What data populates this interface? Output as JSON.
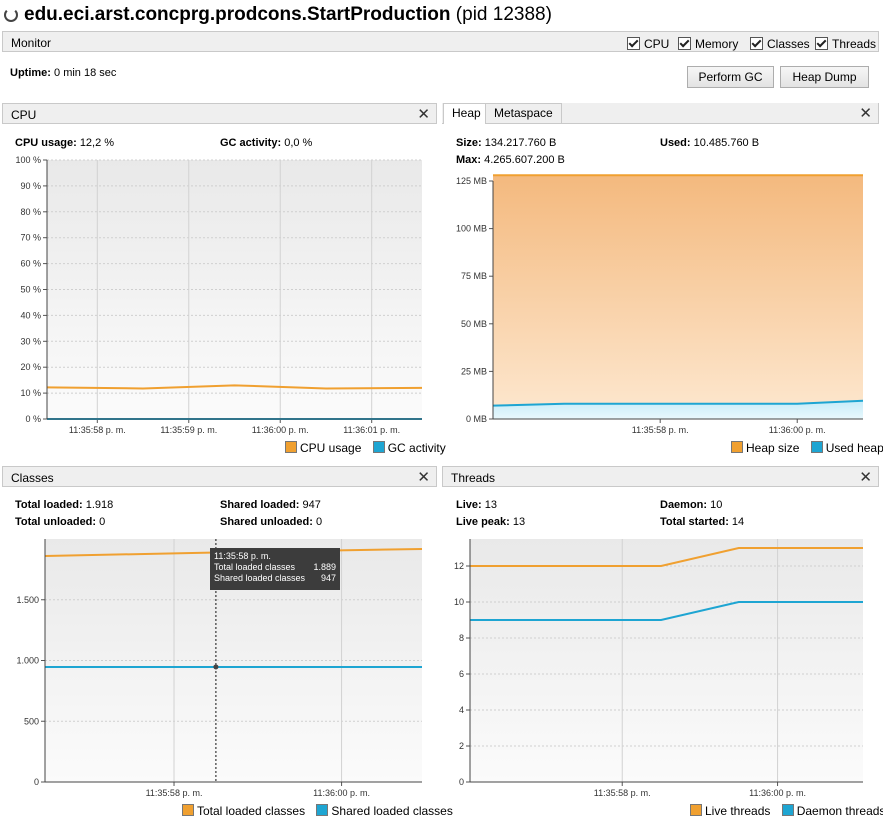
{
  "window": {
    "process": "edu.eci.arst.concprg.prodcons.StartProduction",
    "pid": "(pid 12388)"
  },
  "monitor": {
    "label": "Monitor",
    "checkboxes": [
      {
        "label": "CPU",
        "checked": true
      },
      {
        "label": "Memory",
        "checked": true
      },
      {
        "label": "Classes",
        "checked": true
      },
      {
        "label": "Threads",
        "checked": true
      }
    ],
    "uptime_label": "Uptime:",
    "uptime_value": "0 min 18 sec",
    "perform_gc": "Perform GC",
    "heap_dump": "Heap Dump"
  },
  "cpu": {
    "label": "CPU",
    "close": "✕",
    "usage_label": "CPU usage:",
    "usage_value": "12,2 %",
    "gc_label": "GC activity:",
    "gc_value": "0,0 %",
    "legend": [
      {
        "label": "CPU usage",
        "color": "#f0a030"
      },
      {
        "label": "GC activity",
        "color": "#1ea5d2"
      }
    ]
  },
  "heap": {
    "tabs": [
      "Heap",
      "Metaspace"
    ],
    "close": "✕",
    "size_label": "Size:",
    "size_value": "134.217.760 B",
    "used_label": "Used:",
    "used_value": "10.485.760 B",
    "max_label": "Max:",
    "max_value": "4.265.607.200 B",
    "legend": [
      {
        "label": "Heap size",
        "color": "#f0a030"
      },
      {
        "label": "Used heap",
        "color": "#1ea5d2"
      }
    ]
  },
  "classes": {
    "label": "Classes",
    "close": "✕",
    "total_loaded_label": "Total loaded:",
    "total_loaded_value": "1.918",
    "total_unloaded_label": "Total unloaded:",
    "total_unloaded_value": "0",
    "shared_loaded_label": "Shared loaded:",
    "shared_loaded_value": "947",
    "shared_unloaded_label": "Shared unloaded:",
    "shared_unloaded_value": "0",
    "tooltip": {
      "time": "11:35:58 p. m.",
      "rows": [
        {
          "label": "Total loaded classes",
          "value": "1.889"
        },
        {
          "label": "Shared loaded classes",
          "value": "947"
        }
      ]
    },
    "legend": [
      {
        "label": "Total loaded classes",
        "color": "#f0a030"
      },
      {
        "label": "Shared loaded classes",
        "color": "#1ea5d2"
      }
    ]
  },
  "threads": {
    "label": "Threads",
    "close": "✕",
    "live_label": "Live:",
    "live_value": "13",
    "peak_label": "Live peak:",
    "peak_value": "13",
    "daemon_label": "Daemon:",
    "daemon_value": "10",
    "started_label": "Total started:",
    "started_value": "14",
    "legend": [
      {
        "label": "Live threads",
        "color": "#f0a030"
      },
      {
        "label": "Daemon threads",
        "color": "#1ea5d2"
      }
    ]
  },
  "chart_data": [
    {
      "id": "cpu",
      "type": "line",
      "ylim": [
        0,
        100
      ],
      "yticks": [
        0,
        10,
        20,
        30,
        40,
        50,
        60,
        70,
        80,
        90,
        100
      ],
      "ytick_labels": [
        "0 %",
        "10 %",
        "20 %",
        "30 %",
        "40 %",
        "50 %",
        "60 %",
        "70 %",
        "80 %",
        "90 %",
        "100 %"
      ],
      "xticks": [
        0,
        1,
        2,
        3
      ],
      "xtick_labels": [
        "11:35:58 p. m.",
        "11:35:59 p. m.",
        "11:36:00 p. m.",
        "11:36:01 p. m."
      ],
      "xlim": [
        -0.55,
        3.55
      ],
      "series": [
        {
          "name": "CPU usage",
          "color": "#f0a030",
          "x": [
            -0.55,
            0.5,
            1.5,
            2.5,
            3.55
          ],
          "y": [
            12.2,
            11.8,
            13.0,
            11.8,
            12.0
          ]
        },
        {
          "name": "GC activity",
          "color": "#1ea5d2",
          "x": [
            -0.55,
            3.55
          ],
          "y": [
            0,
            0
          ]
        }
      ]
    },
    {
      "id": "heap",
      "type": "area",
      "ylim": [
        0,
        125
      ],
      "yticks": [
        0,
        25,
        50,
        75,
        100,
        125
      ],
      "ytick_labels": [
        "0 MB",
        "25 MB",
        "50 MB",
        "75 MB",
        "100 MB",
        "125 MB"
      ],
      "xticks": [
        0,
        1
      ],
      "xtick_labels": [
        "11:35:58 p. m.",
        "11:36:00 p. m."
      ],
      "xlim": [
        -1.22,
        1.48
      ],
      "series": [
        {
          "name": "Heap size",
          "color": "#f0a030",
          "x": [
            -1.22,
            1.48
          ],
          "y": [
            128,
            128
          ]
        },
        {
          "name": "Used heap",
          "color": "#1ea5d2",
          "x": [
            -1.22,
            -0.7,
            0.6,
            1.0,
            1.48
          ],
          "y": [
            7,
            8,
            8,
            8,
            9.6
          ]
        }
      ]
    },
    {
      "id": "classes",
      "type": "line",
      "ylim": [
        0,
        2000
      ],
      "yticks": [
        0,
        500,
        1000,
        1500
      ],
      "ytick_labels": [
        "0",
        "500",
        "1.000",
        "1.500"
      ],
      "xticks": [
        0,
        1
      ],
      "xtick_labels": [
        "11:35:58 p. m.",
        "11:36:00 p. m."
      ],
      "xlim": [
        -0.77,
        1.48
      ],
      "cursor_x": 0.25,
      "series": [
        {
          "name": "Total loaded classes",
          "color": "#f0a030",
          "x": [
            -0.77,
            0.25,
            1.48
          ],
          "y": [
            1860,
            1889,
            1918
          ]
        },
        {
          "name": "Shared loaded classes",
          "color": "#1ea5d2",
          "x": [
            -0.77,
            1.48
          ],
          "y": [
            947,
            947
          ]
        }
      ]
    },
    {
      "id": "threads",
      "type": "line",
      "ylim": [
        0,
        13.5
      ],
      "yticks": [
        0,
        2,
        4,
        6,
        8,
        10,
        12
      ],
      "ytick_labels": [
        "0",
        "2",
        "4",
        "6",
        "8",
        "10",
        "12"
      ],
      "xticks": [
        0,
        1
      ],
      "xtick_labels": [
        "11:35:58 p. m.",
        "11:36:00 p. m."
      ],
      "xlim": [
        -0.98,
        1.55
      ],
      "series": [
        {
          "name": "Live threads",
          "color": "#f0a030",
          "x": [
            -0.98,
            0.25,
            0.75,
            1.55
          ],
          "y": [
            12,
            12,
            13,
            13
          ]
        },
        {
          "name": "Daemon threads",
          "color": "#1ea5d2",
          "x": [
            -0.98,
            0.25,
            0.75,
            1.55
          ],
          "y": [
            9,
            9,
            10,
            10
          ]
        }
      ]
    }
  ]
}
